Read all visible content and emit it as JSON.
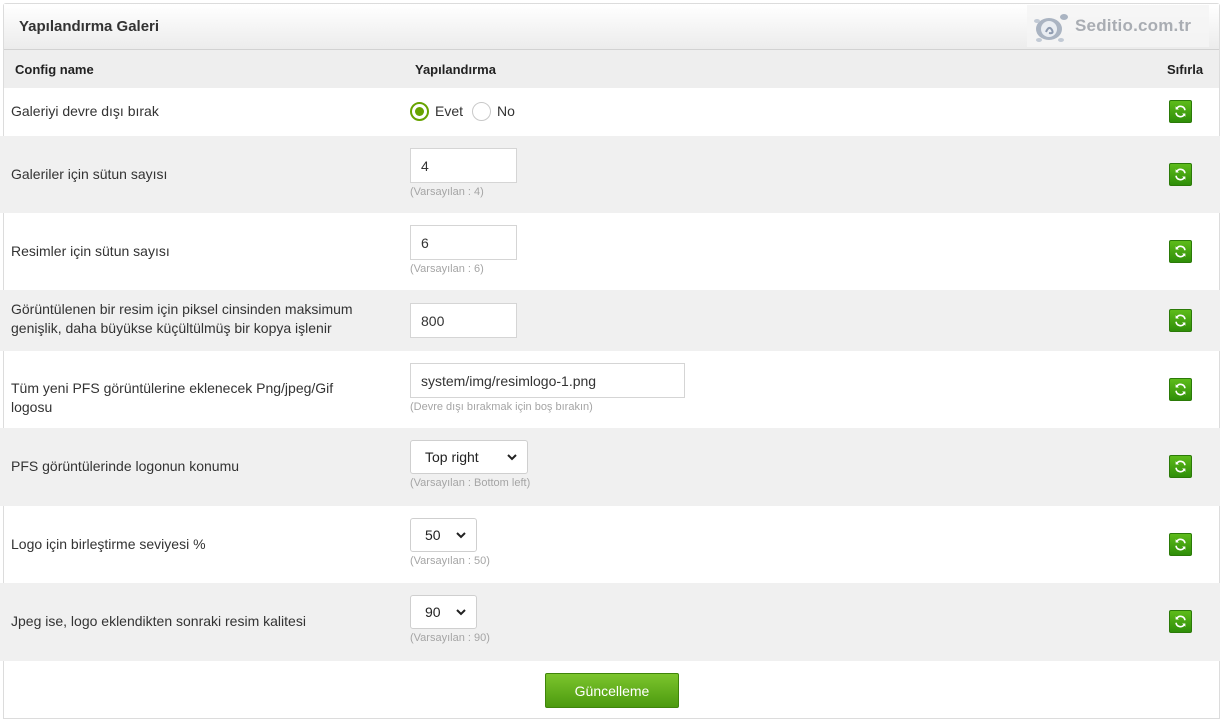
{
  "panel": {
    "title": "Yapılandırma Galeri"
  },
  "brand": {
    "text": "Seditio.com.tr",
    "icon": "seditio-logo-icon"
  },
  "table": {
    "headers": {
      "name": "Config name",
      "config": "Yapılandırma",
      "reset": "Sıfırla"
    },
    "reset_icon": "refresh-icon"
  },
  "rows": [
    {
      "label": "Galeriyi devre dışı bırak",
      "type": "radio",
      "options": [
        "Evet",
        "No"
      ],
      "selected": "Evet"
    },
    {
      "label": "Galeriler için sütun sayısı",
      "type": "text",
      "value": "4",
      "hint": "(Varsayılan : 4)"
    },
    {
      "label": "Resimler için sütun sayısı",
      "type": "text",
      "value": "6",
      "hint": "(Varsayılan : 6)"
    },
    {
      "label": "Görüntülenen bir resim için piksel cinsinden maksimum genişlik, daha büyükse küçültülmüş bir kopya işlenir",
      "type": "text",
      "value": "800"
    },
    {
      "label": "Tüm yeni PFS görüntülerine eklenecek Png/jpeg/Gif logosu",
      "type": "text",
      "value": "system/img/resimlogo-1.png",
      "hint": "(Devre dışı bırakmak için boş bırakın)"
    },
    {
      "label": "PFS görüntülerinde logonun konumu",
      "type": "select",
      "value": "Top right",
      "hint": "(Varsayılan : Bottom left)"
    },
    {
      "label": "Logo için birleştirme seviyesi %",
      "type": "select",
      "value": "50",
      "hint": "(Varsayılan : 50)"
    },
    {
      "label": "Jpeg ise, logo eklendikten sonraki resim kalitesi",
      "type": "select",
      "value": "90",
      "hint": "(Varsayılan : 90)"
    }
  ],
  "submit": {
    "label": "Güncelleme"
  },
  "colors": {
    "accent_green": "#67a300",
    "button_green": "#4c9a0f"
  }
}
